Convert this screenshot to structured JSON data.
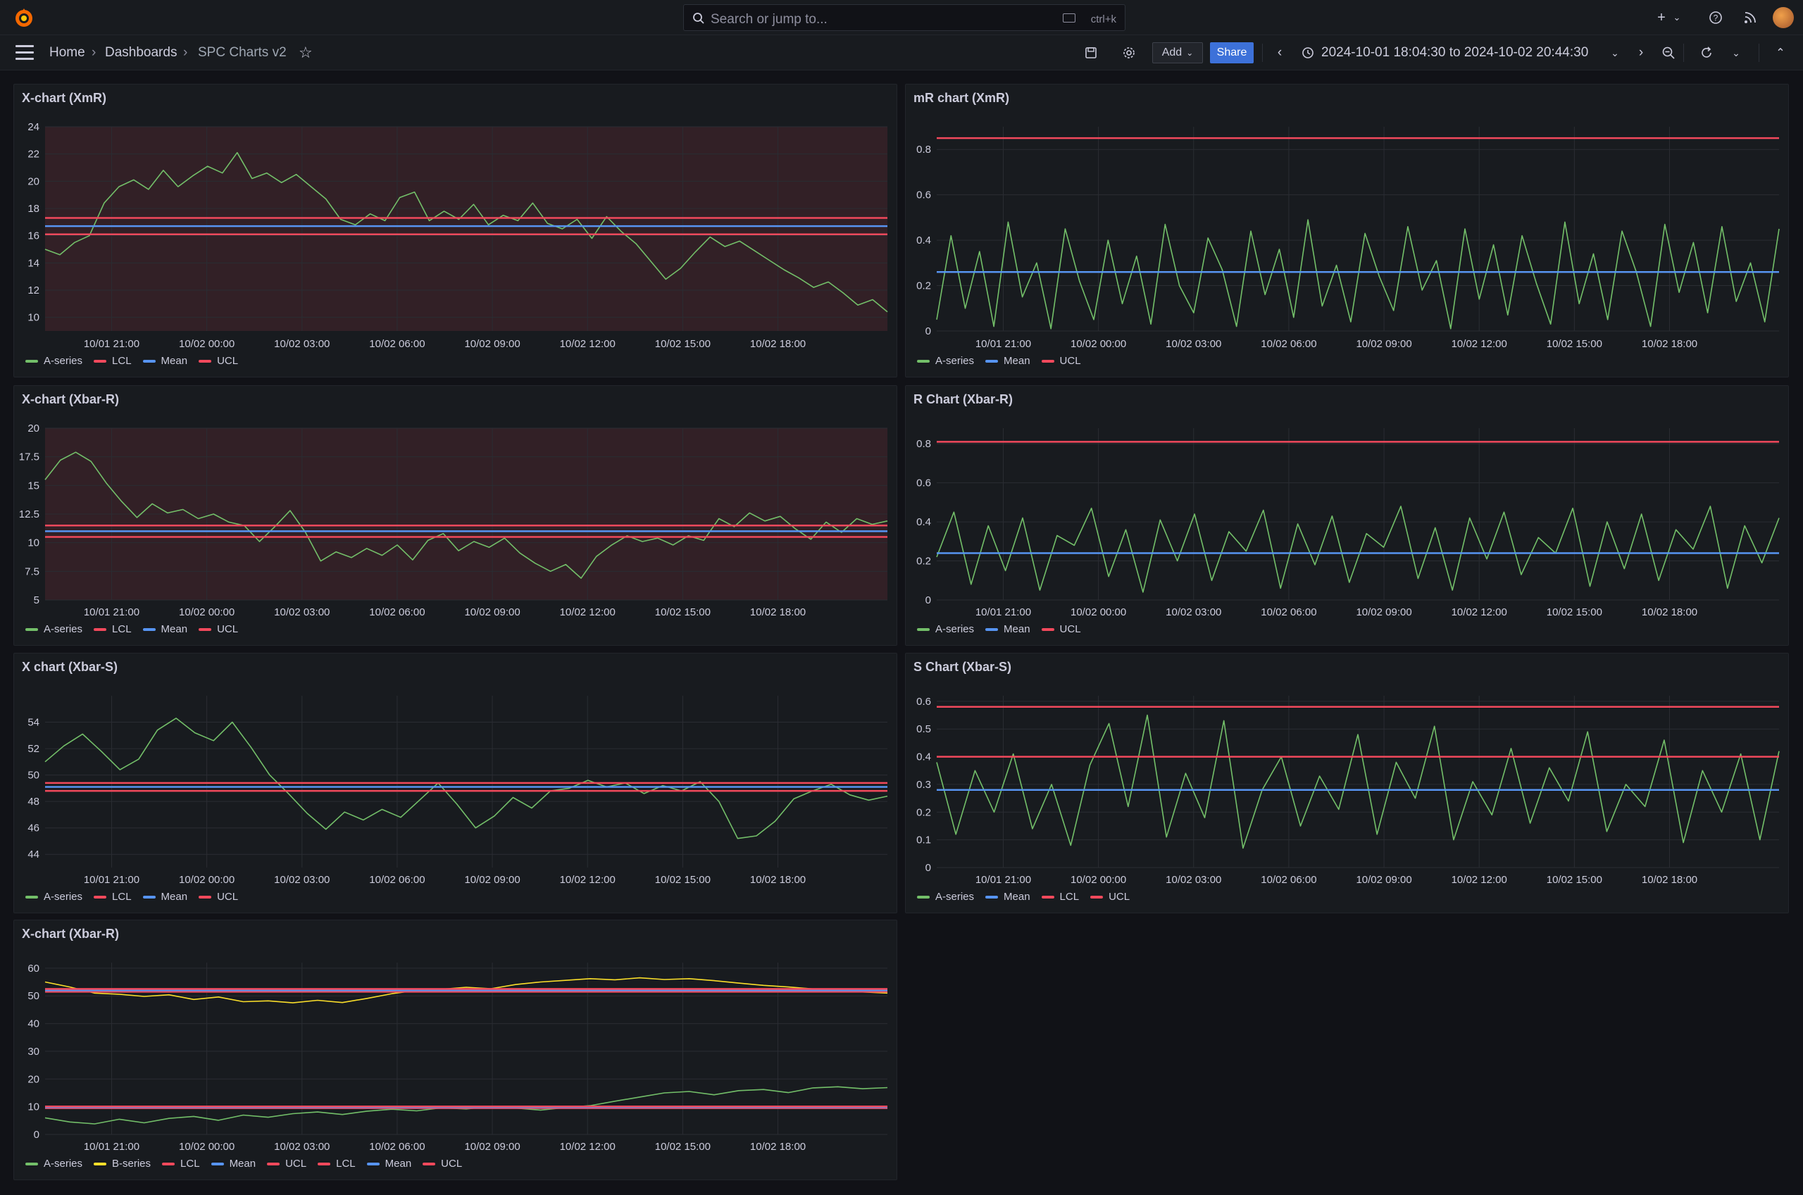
{
  "header": {
    "search_placeholder": "Search or jump to...",
    "search_shortcut": "ctrl+k",
    "icons": [
      "grafana-logo-icon",
      "search-icon",
      "keyboard-icon",
      "plus-icon",
      "chevron-down-icon",
      "help-icon",
      "rss-icon",
      "avatar"
    ]
  },
  "nav": {
    "breadcrumbs": [
      "Home",
      "Dashboards",
      "SPC Charts v2"
    ],
    "add_label": "Add",
    "share_label": "Share",
    "time_range": "2024-10-01 18:04:30 to 2024-10-02 20:44:30"
  },
  "colors": {
    "green": "#73bf69",
    "yellow": "#fade2a",
    "red": "#f2495c",
    "blue": "#5794f2",
    "accent": "#3d71d9"
  },
  "panels": [
    {
      "title": "X-chart (XmR)",
      "legend": [
        {
          "label": "A-series",
          "color": "#73bf69"
        },
        {
          "label": "LCL",
          "color": "#f2495c"
        },
        {
          "label": "Mean",
          "color": "#5794f2"
        },
        {
          "label": "UCL",
          "color": "#f2495c"
        }
      ]
    },
    {
      "title": "mR chart (XmR)",
      "legend": [
        {
          "label": "A-series",
          "color": "#73bf69"
        },
        {
          "label": "Mean",
          "color": "#5794f2"
        },
        {
          "label": "UCL",
          "color": "#f2495c"
        }
      ]
    },
    {
      "title": "X-chart (Xbar-R)",
      "legend": [
        {
          "label": "A-series",
          "color": "#73bf69"
        },
        {
          "label": "LCL",
          "color": "#f2495c"
        },
        {
          "label": "Mean",
          "color": "#5794f2"
        },
        {
          "label": "UCL",
          "color": "#f2495c"
        }
      ]
    },
    {
      "title": "R Chart (Xbar-R)",
      "legend": [
        {
          "label": "A-series",
          "color": "#73bf69"
        },
        {
          "label": "Mean",
          "color": "#5794f2"
        },
        {
          "label": "UCL",
          "color": "#f2495c"
        }
      ]
    },
    {
      "title": "X chart (Xbar-S)",
      "legend": [
        {
          "label": "A-series",
          "color": "#73bf69"
        },
        {
          "label": "LCL",
          "color": "#f2495c"
        },
        {
          "label": "Mean",
          "color": "#5794f2"
        },
        {
          "label": "UCL",
          "color": "#f2495c"
        }
      ]
    },
    {
      "title": "S Chart (Xbar-S)",
      "legend": [
        {
          "label": "A-series",
          "color": "#73bf69"
        },
        {
          "label": "Mean",
          "color": "#5794f2"
        },
        {
          "label": "LCL",
          "color": "#f2495c"
        },
        {
          "label": "UCL",
          "color": "#f2495c"
        }
      ]
    },
    {
      "title": "X-chart (Xbar-R)",
      "legend": [
        {
          "label": "A-series",
          "color": "#73bf69"
        },
        {
          "label": "B-series",
          "color": "#fade2a"
        },
        {
          "label": "LCL",
          "color": "#f2495c"
        },
        {
          "label": "Mean",
          "color": "#5794f2"
        },
        {
          "label": "UCL",
          "color": "#f2495c"
        },
        {
          "label": "LCL",
          "color": "#f2495c"
        },
        {
          "label": "Mean",
          "color": "#5794f2"
        },
        {
          "label": "UCL",
          "color": "#f2495c"
        }
      ]
    }
  ],
  "chart_data": [
    {
      "type": "line",
      "title": "X-chart (XmR)",
      "x_ticks": [
        "10/01 21:00",
        "10/02 00:00",
        "10/02 03:00",
        "10/02 06:00",
        "10/02 09:00",
        "10/02 12:00",
        "10/02 15:00",
        "10/02 18:00"
      ],
      "y_ticks": [
        10,
        12,
        14,
        16,
        18,
        20,
        22,
        24
      ],
      "ylim": [
        9,
        24
      ],
      "shaded_out_of_control": true,
      "series": [
        {
          "name": "A-series",
          "color": "#73bf69",
          "values": [
            15,
            14.6,
            15.5,
            16,
            18.4,
            19.6,
            20.1,
            19.4,
            20.8,
            19.6,
            20.4,
            21.1,
            20.6,
            22.1,
            20.2,
            20.6,
            19.9,
            20.5,
            19.6,
            18.7,
            17.2,
            16.8,
            17.6,
            17.1,
            18.8,
            19.2,
            17.1,
            17.8,
            17.2,
            18.3,
            16.8,
            17.5,
            17.1,
            18.4,
            16.9,
            16.5,
            17.2,
            15.8,
            17.4,
            16.3,
            15.4,
            14.1,
            12.8,
            13.6,
            14.8,
            15.9,
            15.2,
            15.6,
            14.9,
            14.2,
            13.5,
            12.9,
            12.2,
            12.6,
            11.8,
            10.9,
            11.3,
            10.4
          ]
        },
        {
          "name": "LCL",
          "color": "#f2495c",
          "values": [
            16.1
          ]
        },
        {
          "name": "Mean",
          "color": "#5794f2",
          "values": [
            16.7
          ]
        },
        {
          "name": "UCL",
          "color": "#f2495c",
          "values": [
            17.3
          ]
        }
      ]
    },
    {
      "type": "line",
      "title": "mR chart (XmR)",
      "x_ticks": [
        "10/01 21:00",
        "10/02 00:00",
        "10/02 03:00",
        "10/02 06:00",
        "10/02 09:00",
        "10/02 12:00",
        "10/02 15:00",
        "10/02 18:00"
      ],
      "y_ticks": [
        0,
        0.2,
        0.4,
        0.6,
        0.8
      ],
      "ylim": [
        0,
        0.9
      ],
      "series": [
        {
          "name": "A-series",
          "color": "#73bf69",
          "values": [
            0.05,
            0.42,
            0.1,
            0.35,
            0.02,
            0.48,
            0.15,
            0.3,
            0.01,
            0.45,
            0.22,
            0.05,
            0.4,
            0.12,
            0.33,
            0.03,
            0.47,
            0.2,
            0.08,
            0.41,
            0.27,
            0.02,
            0.44,
            0.16,
            0.36,
            0.06,
            0.49,
            0.11,
            0.29,
            0.04,
            0.43,
            0.24,
            0.09,
            0.46,
            0.18,
            0.31,
            0.01,
            0.45,
            0.14,
            0.38,
            0.07,
            0.42,
            0.21,
            0.03,
            0.48,
            0.12,
            0.34,
            0.05,
            0.44,
            0.26,
            0.02,
            0.47,
            0.17,
            0.39,
            0.08,
            0.46,
            0.13,
            0.3,
            0.04,
            0.45
          ]
        },
        {
          "name": "Mean",
          "color": "#5794f2",
          "values": [
            0.26
          ]
        },
        {
          "name": "UCL",
          "color": "#f2495c",
          "values": [
            0.85
          ]
        }
      ]
    },
    {
      "type": "line",
      "title": "X-chart (Xbar-R)",
      "x_ticks": [
        "10/01 21:00",
        "10/02 00:00",
        "10/02 03:00",
        "10/02 06:00",
        "10/02 09:00",
        "10/02 12:00",
        "10/02 15:00",
        "10/02 18:00"
      ],
      "y_ticks": [
        5,
        7.5,
        10,
        12.5,
        15,
        17.5,
        20
      ],
      "ylim": [
        5,
        20
      ],
      "shaded_out_of_control": true,
      "series": [
        {
          "name": "A-series",
          "color": "#73bf69",
          "values": [
            15.5,
            17.2,
            17.9,
            17.1,
            15.2,
            13.6,
            12.2,
            13.4,
            12.6,
            12.9,
            12.1,
            12.5,
            11.8,
            11.5,
            10.1,
            11.4,
            12.8,
            10.9,
            8.4,
            9.2,
            8.7,
            9.5,
            8.9,
            9.8,
            8.5,
            10.2,
            10.8,
            9.3,
            10.1,
            9.6,
            10.4,
            9.1,
            8.2,
            7.5,
            8.1,
            6.9,
            8.8,
            9.8,
            10.6,
            10.1,
            10.4,
            9.8,
            10.6,
            10.2,
            12.1,
            11.4,
            12.6,
            11.9,
            12.3,
            11.2,
            10.3,
            11.8,
            10.9,
            12.1,
            11.6,
            11.9
          ]
        },
        {
          "name": "LCL",
          "color": "#f2495c",
          "values": [
            10.5
          ]
        },
        {
          "name": "Mean",
          "color": "#5794f2",
          "values": [
            11
          ]
        },
        {
          "name": "UCL",
          "color": "#f2495c",
          "values": [
            11.5
          ]
        }
      ]
    },
    {
      "type": "line",
      "title": "R Chart (Xbar-R)",
      "x_ticks": [
        "10/01 21:00",
        "10/02 00:00",
        "10/02 03:00",
        "10/02 06:00",
        "10/02 09:00",
        "10/02 12:00",
        "10/02 15:00",
        "10/02 18:00"
      ],
      "y_ticks": [
        0,
        0.2,
        0.4,
        0.6,
        0.8
      ],
      "ylim": [
        0,
        0.88
      ],
      "series": [
        {
          "name": "A-series",
          "color": "#73bf69",
          "values": [
            0.22,
            0.45,
            0.08,
            0.38,
            0.15,
            0.42,
            0.05,
            0.33,
            0.28,
            0.47,
            0.12,
            0.36,
            0.04,
            0.41,
            0.2,
            0.44,
            0.1,
            0.35,
            0.25,
            0.46,
            0.06,
            0.39,
            0.18,
            0.43,
            0.09,
            0.34,
            0.27,
            0.48,
            0.11,
            0.37,
            0.05,
            0.42,
            0.21,
            0.45,
            0.13,
            0.32,
            0.24,
            0.47,
            0.07,
            0.4,
            0.16,
            0.44,
            0.1,
            0.36,
            0.26,
            0.48,
            0.06,
            0.38,
            0.19,
            0.42
          ]
        },
        {
          "name": "Mean",
          "color": "#5794f2",
          "values": [
            0.24
          ]
        },
        {
          "name": "UCL",
          "color": "#f2495c",
          "values": [
            0.81
          ]
        }
      ]
    },
    {
      "type": "line",
      "title": "X chart (Xbar-S)",
      "x_ticks": [
        "10/01 21:00",
        "10/02 00:00",
        "10/02 03:00",
        "10/02 06:00",
        "10/02 09:00",
        "10/02 12:00",
        "10/02 15:00",
        "10/02 18:00"
      ],
      "y_ticks": [
        44,
        46,
        48,
        50,
        52,
        54
      ],
      "ylim": [
        43,
        56
      ],
      "series": [
        {
          "name": "A-series",
          "color": "#73bf69",
          "values": [
            51,
            52.2,
            53.1,
            51.8,
            50.4,
            51.2,
            53.4,
            54.3,
            53.2,
            52.6,
            54,
            52.1,
            50,
            48.6,
            47.1,
            45.9,
            47.2,
            46.6,
            47.4,
            46.8,
            48.1,
            49.4,
            47.8,
            46,
            46.9,
            48.3,
            47.5,
            48.8,
            49,
            49.6,
            49.1,
            49.4,
            48.6,
            49.2,
            48.8,
            49.5,
            48,
            45.2,
            45.4,
            46.5,
            48.2,
            48.8,
            49.3,
            48.5,
            48.1,
            48.4
          ]
        },
        {
          "name": "LCL",
          "color": "#f2495c",
          "values": [
            48.8
          ]
        },
        {
          "name": "Mean",
          "color": "#5794f2",
          "values": [
            49.1
          ]
        },
        {
          "name": "UCL",
          "color": "#f2495c",
          "values": [
            49.4
          ]
        }
      ]
    },
    {
      "type": "line",
      "title": "S Chart (Xbar-S)",
      "x_ticks": [
        "10/01 21:00",
        "10/02 00:00",
        "10/02 03:00",
        "10/02 06:00",
        "10/02 09:00",
        "10/02 12:00",
        "10/02 15:00",
        "10/02 18:00"
      ],
      "y_ticks": [
        0,
        0.1,
        0.2,
        0.3,
        0.4,
        0.5,
        0.6
      ],
      "ylim": [
        0,
        0.62
      ],
      "series": [
        {
          "name": "A-series",
          "color": "#73bf69",
          "values": [
            0.38,
            0.12,
            0.35,
            0.2,
            0.41,
            0.14,
            0.3,
            0.08,
            0.37,
            0.52,
            0.22,
            0.55,
            0.11,
            0.34,
            0.18,
            0.53,
            0.07,
            0.28,
            0.4,
            0.15,
            0.33,
            0.21,
            0.48,
            0.12,
            0.38,
            0.25,
            0.51,
            0.1,
            0.31,
            0.19,
            0.43,
            0.16,
            0.36,
            0.24,
            0.49,
            0.13,
            0.3,
            0.22,
            0.46,
            0.09,
            0.35,
            0.2,
            0.41,
            0.1,
            0.42
          ]
        },
        {
          "name": "Mean",
          "color": "#5794f2",
          "values": [
            0.28
          ]
        },
        {
          "name": "LCL",
          "color": "#f2495c",
          "values": [
            0.4
          ]
        },
        {
          "name": "UCL",
          "color": "#f2495c",
          "values": [
            0.58
          ]
        }
      ]
    },
    {
      "type": "line",
      "title": "X-chart (Xbar-R)",
      "x_ticks": [
        "10/01 21:00",
        "10/02 00:00",
        "10/02 03:00",
        "10/02 06:00",
        "10/02 09:00",
        "10/02 12:00",
        "10/02 15:00",
        "10/02 18:00"
      ],
      "y_ticks": [
        0,
        10,
        20,
        30,
        40,
        50,
        60
      ],
      "ylim": [
        0,
        62
      ],
      "series": [
        {
          "name": "A-series",
          "color": "#73bf69",
          "values": [
            6,
            4.5,
            3.8,
            5.5,
            4.2,
            5.8,
            6.5,
            5.1,
            7,
            6.2,
            7.5,
            8.1,
            7.2,
            8.4,
            9.1,
            8.5,
            9.6,
            9.2,
            10.1,
            9.5,
            8.8,
            9.7,
            10.4,
            12,
            13.5,
            15,
            15.5,
            14.3,
            15.8,
            16.2,
            15.1,
            16.8,
            17.2,
            16.5,
            16.9
          ]
        },
        {
          "name": "B-series",
          "color": "#fade2a",
          "values": [
            55,
            53.2,
            51,
            50.6,
            49.8,
            50.4,
            48.7,
            49.6,
            47.9,
            48.2,
            47.5,
            48.4,
            47.6,
            49.1,
            50.8,
            52,
            52.4,
            53.1,
            52.6,
            54.1,
            55,
            55.6,
            56.2,
            55.8,
            56.5,
            55.9,
            56.2,
            55.5,
            54.6,
            53.8,
            53.2,
            52.5,
            51.8,
            51.4,
            51
          ]
        },
        {
          "name": "LCL",
          "color": "#f2495c",
          "values": [
            51.5
          ]
        },
        {
          "name": "Mean",
          "color": "#5794f2",
          "values": [
            52
          ]
        },
        {
          "name": "UCL",
          "color": "#f2495c",
          "values": [
            52.5
          ]
        },
        {
          "name": "LCL",
          "color": "#f2495c",
          "values": [
            9.5
          ]
        },
        {
          "name": "Mean",
          "color": "#5794f2",
          "values": [
            9.8
          ]
        },
        {
          "name": "UCL",
          "color": "#f2495c",
          "values": [
            10.1
          ]
        }
      ]
    }
  ]
}
